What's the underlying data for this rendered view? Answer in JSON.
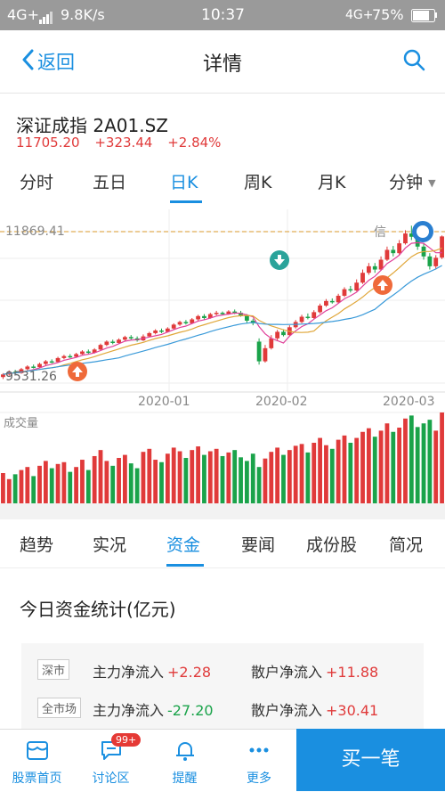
{
  "status_bar": {
    "network": "4G+",
    "speed": "9.8K/s",
    "time": "10:37",
    "network2": "4G+",
    "battery": "75%"
  },
  "nav": {
    "back_label": "返回",
    "title": "详情"
  },
  "stock": {
    "name": "深证成指 2A01.SZ",
    "price": "11705.20",
    "change": "+323.44",
    "change_pct": "+2.84%"
  },
  "period_tabs": [
    "分时",
    "五日",
    "日K",
    "周K",
    "月K",
    "分钟"
  ],
  "active_period": "日K",
  "chart_data": {
    "type": "candlestick",
    "high_label": "11869.41",
    "low_label": "9531.26",
    "high_tag": "信",
    "x_ticks": [
      "2020-01",
      "2020-02",
      "2020-03"
    ],
    "volume_label": "成交量",
    "ylim": [
      9400,
      12050
    ],
    "candles": [
      [
        9560,
        9600,
        9530,
        9620
      ],
      [
        9600,
        9640,
        9580,
        9660
      ],
      [
        9640,
        9620,
        9600,
        9670
      ],
      [
        9620,
        9680,
        9610,
        9700
      ],
      [
        9680,
        9720,
        9660,
        9740
      ],
      [
        9720,
        9710,
        9690,
        9750
      ],
      [
        9710,
        9760,
        9700,
        9780
      ],
      [
        9760,
        9800,
        9740,
        9820
      ],
      [
        9800,
        9790,
        9770,
        9830
      ],
      [
        9790,
        9850,
        9780,
        9870
      ],
      [
        9850,
        9880,
        9830,
        9900
      ],
      [
        9880,
        9870,
        9850,
        9910
      ],
      [
        9870,
        9910,
        9860,
        9930
      ],
      [
        9910,
        9950,
        9900,
        9970
      ],
      [
        9950,
        9930,
        9910,
        9980
      ],
      [
        9930,
        9980,
        9920,
        10000
      ],
      [
        9980,
        10050,
        9970,
        10070
      ],
      [
        10050,
        10100,
        10030,
        10120
      ],
      [
        10100,
        10080,
        10060,
        10130
      ],
      [
        10080,
        10130,
        10070,
        10150
      ],
      [
        10130,
        10170,
        10110,
        10190
      ],
      [
        10170,
        10150,
        10130,
        10200
      ],
      [
        10150,
        10120,
        10100,
        10180
      ],
      [
        10120,
        10180,
        10110,
        10210
      ],
      [
        10180,
        10230,
        10170,
        10250
      ],
      [
        10230,
        10270,
        10210,
        10290
      ],
      [
        10270,
        10250,
        10230,
        10300
      ],
      [
        10250,
        10300,
        10240,
        10320
      ],
      [
        10300,
        10360,
        10290,
        10380
      ],
      [
        10360,
        10400,
        10340,
        10420
      ],
      [
        10400,
        10380,
        10360,
        10430
      ],
      [
        10380,
        10440,
        10370,
        10460
      ],
      [
        10440,
        10490,
        10420,
        10510
      ],
      [
        10490,
        10460,
        10440,
        10520
      ],
      [
        10460,
        10520,
        10450,
        10540
      ],
      [
        10520,
        10540,
        10500,
        10570
      ],
      [
        10540,
        10520,
        10500,
        10560
      ],
      [
        10520,
        10560,
        10510,
        10580
      ],
      [
        10560,
        10540,
        10520,
        10590
      ],
      [
        10540,
        10500,
        10480,
        10570
      ],
      [
        10500,
        10420,
        10380,
        10520
      ],
      [
        10420,
        10380,
        10350,
        10450
      ],
      [
        10100,
        9800,
        9750,
        10150
      ],
      [
        9800,
        10000,
        9780,
        10050
      ],
      [
        10000,
        10150,
        9980,
        10200
      ],
      [
        10150,
        10250,
        10120,
        10280
      ],
      [
        10250,
        10200,
        10180,
        10290
      ],
      [
        10200,
        10320,
        10190,
        10350
      ],
      [
        10320,
        10400,
        10300,
        10430
      ],
      [
        10400,
        10480,
        10380,
        10510
      ],
      [
        10480,
        10460,
        10440,
        10530
      ],
      [
        10460,
        10550,
        10450,
        10580
      ],
      [
        10550,
        10650,
        10530,
        10680
      ],
      [
        10650,
        10720,
        10630,
        10750
      ],
      [
        10720,
        10700,
        10680,
        10760
      ],
      [
        10700,
        10800,
        10690,
        10830
      ],
      [
        10800,
        10900,
        10780,
        10930
      ],
      [
        10900,
        10880,
        10850,
        10950
      ],
      [
        10880,
        11000,
        10870,
        11050
      ],
      [
        11000,
        11150,
        10980,
        11200
      ],
      [
        11150,
        11250,
        11120,
        11300
      ],
      [
        11250,
        11200,
        11150,
        11300
      ],
      [
        11200,
        11350,
        11180,
        11400
      ],
      [
        11350,
        11500,
        11330,
        11550
      ],
      [
        11500,
        11450,
        11400,
        11560
      ],
      [
        11450,
        11600,
        11430,
        11650
      ],
      [
        11600,
        11750,
        11580,
        11800
      ],
      [
        11750,
        11700,
        11650,
        11869
      ],
      [
        11700,
        11550,
        11500,
        11760
      ],
      [
        11550,
        11400,
        11350,
        11600
      ],
      [
        11400,
        11250,
        11200,
        11450
      ],
      [
        11250,
        11380,
        11200,
        11420
      ],
      [
        11382,
        11705,
        11360,
        11720
      ]
    ],
    "volumes": [
      50,
      40,
      48,
      55,
      60,
      45,
      62,
      70,
      58,
      65,
      68,
      52,
      60,
      72,
      55,
      78,
      88,
      70,
      62,
      75,
      80,
      66,
      58,
      85,
      90,
      72,
      68,
      82,
      92,
      86,
      75,
      88,
      94,
      80,
      86,
      90,
      78,
      84,
      88,
      76,
      70,
      82,
      60,
      74,
      85,
      92,
      80,
      88,
      95,
      98,
      84,
      100,
      108,
      96,
      90,
      105,
      112,
      100,
      108,
      118,
      124,
      110,
      120,
      132,
      118,
      125,
      140,
      145,
      126,
      132,
      138,
      120,
      150
    ]
  },
  "info_tabs": [
    "趋势",
    "实况",
    "资金",
    "要闻",
    "成份股",
    "简况"
  ],
  "active_info": "资金",
  "fund_stats": {
    "title": "今日资金统计(亿元)",
    "rows": [
      {
        "market": "深市",
        "main_label": "主力净流入",
        "main_value": "+2.28",
        "retail_label": "散户净流入",
        "retail_value": "+11.88"
      },
      {
        "market": "全市场",
        "main_label": "主力净流入",
        "main_value": "-27.20",
        "retail_label": "散户净流入",
        "retail_value": "+30.41"
      }
    ]
  },
  "tab_bar": {
    "items": [
      "股票首页",
      "讨论区",
      "提醒",
      "更多"
    ],
    "badge": "99+",
    "buy_label": "买一笔"
  },
  "colors": {
    "accent": "#1a8fe0",
    "up": "#e03a3a",
    "down": "#1aa34a",
    "status_bar": "#9a9a9a"
  }
}
